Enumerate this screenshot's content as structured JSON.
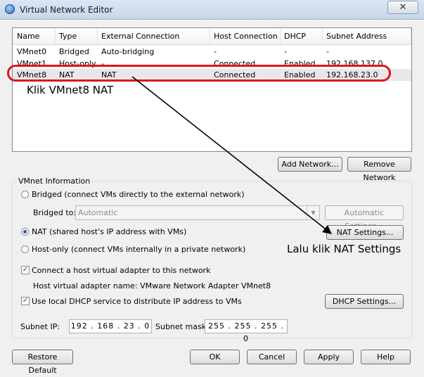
{
  "window": {
    "title": "Virtual Network Editor",
    "close_label": "✕"
  },
  "list": {
    "columns": [
      "Name",
      "Type",
      "External Connection",
      "Host Connection",
      "DHCP",
      "Subnet Address"
    ],
    "rows": [
      [
        "VMnet0",
        "Bridged",
        "Auto-bridging",
        "-",
        "-",
        "-"
      ],
      [
        "VMnet1",
        "Host-only",
        "-",
        "Connected",
        "Enabled",
        "192.168.137.0"
      ],
      [
        "VMnet8",
        "NAT",
        "NAT",
        "Connected",
        "Enabled",
        "192.168.23.0"
      ]
    ],
    "selected_row": 2
  },
  "list_buttons": {
    "add_network": "Add Network...",
    "remove_network": "Remove Network"
  },
  "vmnet_info": {
    "group_title": "VMnet Information",
    "bridged_label": "Bridged (connect VMs directly to the external network)",
    "bridged_to_label": "Bridged to:",
    "bridged_to_value": "Automatic",
    "auto_settings": "Automatic Settings...",
    "nat_label": "NAT (shared host's IP address with VMs)",
    "nat_settings": "NAT Settings...",
    "hostonly_label": "Host-only (connect VMs internally in a private network)",
    "connect_adapter_label": "Connect a host virtual adapter to this network",
    "adapter_name_label": "Host virtual adapter name: VMware Network Adapter VMnet8",
    "dhcp_label": "Use local DHCP service to distribute IP address to VMs",
    "dhcp_settings": "DHCP Settings...",
    "subnet_ip_label": "Subnet IP:",
    "subnet_ip": [
      "192",
      "168",
      "23",
      "0"
    ],
    "subnet_mask_label": "Subnet mask:",
    "subnet_mask": [
      "255",
      "255",
      "255",
      "0"
    ],
    "selected_mode": "nat",
    "connect_adapter_checked": true,
    "dhcp_checked": true
  },
  "footer": {
    "restore_default": "Restore Default",
    "ok": "OK",
    "cancel": "Cancel",
    "apply": "Apply",
    "help": "Help"
  },
  "annotations": {
    "step1": "Klik VMnet8 NAT",
    "step2": "Lalu klik NAT Settings",
    "color": "#e0161c"
  }
}
